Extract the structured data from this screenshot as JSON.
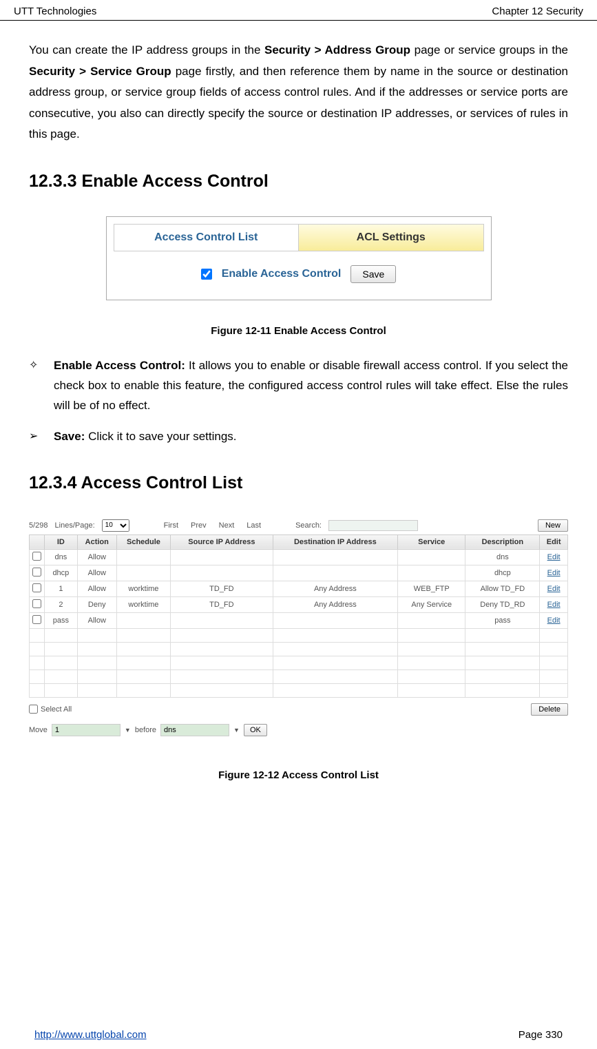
{
  "header": {
    "left": "UTT Technologies",
    "right": "Chapter 12 Security"
  },
  "footer": {
    "url": "http://www.uttglobal.com",
    "page": "Page 330"
  },
  "para1_parts": {
    "t1": "You can create the IP address groups in the ",
    "b1": "Security > Address Group",
    "t2": " page or service groups in the ",
    "b2": "Security > Service Group",
    "t3": " page firstly, and then reference them by name in the source or destination address group, or service group fields of access control rules. And if the addresses or service ports are consecutive, you also can directly specify the source or destination IP addresses, or services of rules in this page."
  },
  "heading_1233": "12.3.3  Enable Access Control",
  "fig1": {
    "tab_left": "Access Control List",
    "tab_right": "ACL Settings",
    "enable_label": "Enable Access Control",
    "save_btn": "Save",
    "caption": "Figure 12-11 Enable Access Control"
  },
  "bullet1": {
    "sym": "✧",
    "bold": "Enable Access Control:",
    "text": " It allows you to enable or disable firewall access control. If you select the check box to enable this feature, the configured access control rules will take effect. Else the rules will be of no effect."
  },
  "bullet2": {
    "sym": "➢",
    "bold": "Save:",
    "text": " Click it to save your settings."
  },
  "heading_1234": "12.3.4  Access Control List",
  "fig2": {
    "count": "5/298",
    "lines_label": "Lines/Page:",
    "lines_value": "10",
    "pager": {
      "first": "First",
      "prev": "Prev",
      "next": "Next",
      "last": "Last"
    },
    "search_label": "Search:",
    "new_btn": "New",
    "headers": [
      "",
      "ID",
      "Action",
      "Schedule",
      "Source IP Address",
      "Destination IP Address",
      "Service",
      "Description",
      "Edit"
    ],
    "rows": [
      {
        "id": "dns",
        "action": "Allow",
        "schedule": "",
        "src": "",
        "dst": "",
        "svc": "",
        "desc": "dns",
        "edit": "Edit"
      },
      {
        "id": "dhcp",
        "action": "Allow",
        "schedule": "",
        "src": "",
        "dst": "",
        "svc": "",
        "desc": "dhcp",
        "edit": "Edit"
      },
      {
        "id": "1",
        "action": "Allow",
        "schedule": "worktime",
        "src": "TD_FD",
        "dst": "Any Address",
        "svc": "WEB_FTP",
        "desc": "Allow TD_FD",
        "edit": "Edit"
      },
      {
        "id": "2",
        "action": "Deny",
        "schedule": "worktime",
        "src": "TD_FD",
        "dst": "Any Address",
        "svc": "Any Service",
        "desc": "Deny TD_RD",
        "edit": "Edit"
      },
      {
        "id": "pass",
        "action": "Allow",
        "schedule": "",
        "src": "",
        "dst": "",
        "svc": "",
        "desc": "pass",
        "edit": "Edit"
      }
    ],
    "select_all": "Select All",
    "delete_btn": "Delete",
    "move_label": "Move",
    "move_val1": "1",
    "before_label": "before",
    "move_val2": "dns",
    "ok_btn": "OK",
    "caption": "Figure 12-12 Access Control List"
  }
}
